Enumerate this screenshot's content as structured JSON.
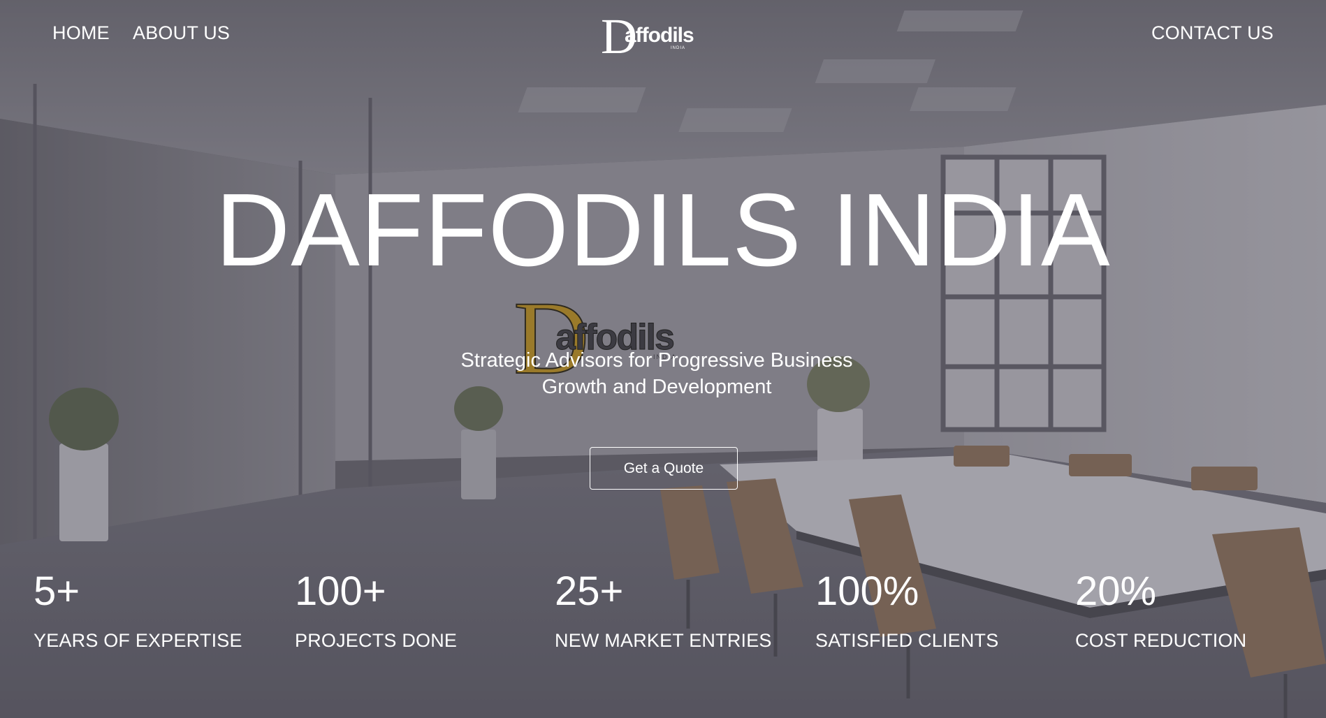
{
  "nav": {
    "home_label": "HOME",
    "about_label": "ABOUT US",
    "contact_label": "CONTACT US"
  },
  "brand": {
    "logo_text": "Daffodils",
    "logo_sub": "INDIA"
  },
  "hero": {
    "title": "DAFFODILS INDIA",
    "subtitle_line1": "Strategic Advisors for Progressive Business",
    "subtitle_line2": "Growth and Development",
    "cta_label": "Get a Quote"
  },
  "stats": [
    {
      "value": "5+",
      "label": "YEARS OF EXPERTISE"
    },
    {
      "value": "100+",
      "label": "PROJECTS DONE"
    },
    {
      "value": "25+",
      "label": "NEW MARKET ENTRIES"
    },
    {
      "value": "100%",
      "label": "SATISFIED CLIENTS"
    },
    {
      "value": "20%",
      "label": "COST REDUCTION"
    }
  ],
  "colors": {
    "text": "#ffffff",
    "overlay": "#585660",
    "logo_gold": "#9a7a2a"
  },
  "icons": {
    "background": "office-meeting-room-photo",
    "logo": "daffodils-logo"
  }
}
